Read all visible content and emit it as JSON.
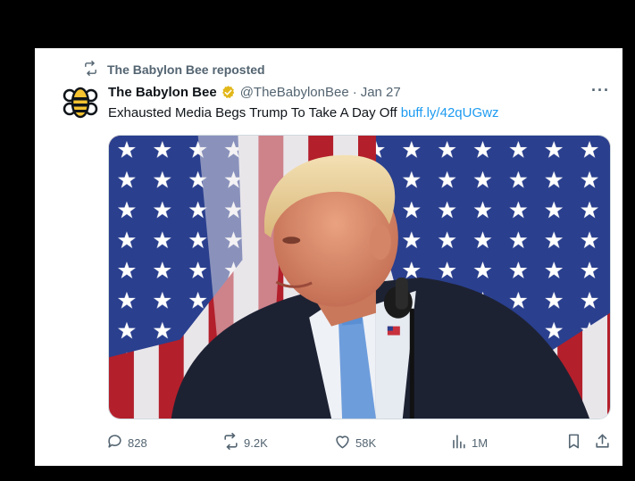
{
  "repost_banner": {
    "text": "The Babylon Bee reposted"
  },
  "tweet": {
    "author_name": "The Babylon Bee",
    "handle": "@TheBabylonBee",
    "separator": "·",
    "date": "Jan 27",
    "more_label": "···",
    "text": "Exhausted Media Begs Trump To Take A Day Off ",
    "link": "buff.ly/42qUGwz"
  },
  "actions": {
    "replies": "828",
    "reposts": "9.2K",
    "likes": "58K",
    "views": "1M"
  },
  "colors": {
    "link": "#1d9bf0",
    "secondary_text": "#536471",
    "verified_gold": "#e2b719",
    "logo_yellow": "#f6c431"
  },
  "icons": [
    "repost-icon",
    "babylon-bee-logo",
    "verified-badge-icon",
    "more-icon",
    "reply-icon",
    "repost-icon",
    "like-icon",
    "views-icon",
    "bookmark-icon",
    "share-icon"
  ]
}
